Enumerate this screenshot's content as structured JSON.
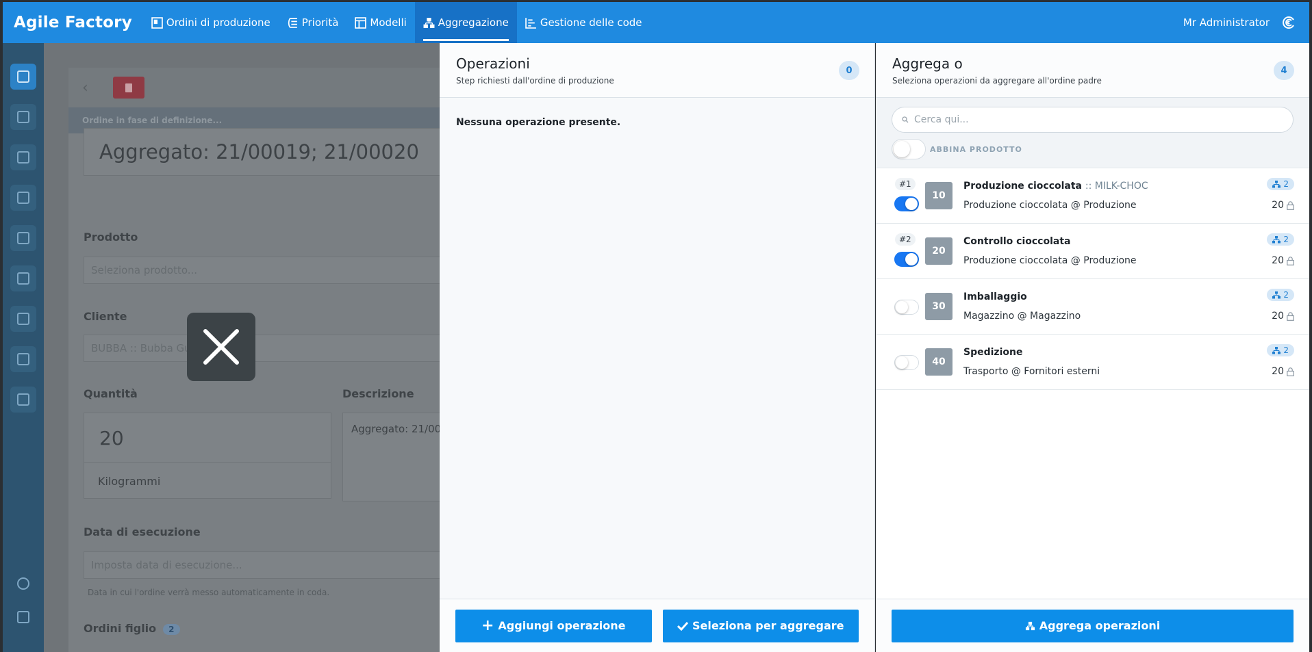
{
  "app": {
    "title": "Agile Factory",
    "user": "Mr Administrator"
  },
  "nav": [
    {
      "label": "Ordini di produzione",
      "icon": "orders-icon",
      "active": false
    },
    {
      "label": "Priorità",
      "icon": "priority-icon",
      "active": false
    },
    {
      "label": "Modelli",
      "icon": "models-icon",
      "active": false
    },
    {
      "label": "Aggregazione",
      "icon": "aggregation-icon",
      "active": true
    },
    {
      "label": "Gestione delle code",
      "icon": "queue-icon",
      "active": false
    }
  ],
  "background_form": {
    "status": "Ordine in fase di definizione...",
    "title": "Aggregato: 21/00019; 21/00020",
    "product_label": "Prodotto",
    "product_placeholder": "Seleziona prodotto...",
    "client_label": "Cliente",
    "client_value": "BUBBA :: Bubba Gum",
    "qty_label": "Quantità",
    "qty_value": "20",
    "unit_value": "Kilogrammi",
    "desc_label": "Descrizione",
    "desc_value": "Aggregato: 21/00",
    "date_label": "Data di esecuzione",
    "date_placeholder": "Imposta data di esecuzione...",
    "date_hint": "Data in cui l'ordine verrà messo automaticamente in coda.",
    "children_label": "Ordini figlio",
    "children_count": "2"
  },
  "operations_panel": {
    "title": "Operazioni",
    "subtitle": "Step richiesti dall'ordine di produzione",
    "count": "0",
    "empty": "Nessuna operazione presente.",
    "add_button": "Aggiungi operazione",
    "select_button": "Seleziona per aggregare"
  },
  "aggregate_panel": {
    "title": "Aggrega o",
    "subtitle": "Seleziona operazioni da aggregare all'ordine padre",
    "count": "4",
    "search_placeholder": "Cerca qui...",
    "match_product_label": "ABBINA PRODOTTO",
    "aggregate_button": "Aggrega operazioni",
    "operations": [
      {
        "index": "#1",
        "selected": true,
        "number": "10",
        "name": "Produzione cioccolata",
        "code": ":: MILK-CHOC",
        "place": "Produzione cioccolata @ Produzione",
        "aggregated": "2",
        "qty": "20"
      },
      {
        "index": "#2",
        "selected": true,
        "number": "20",
        "name": "Controllo cioccolata",
        "code": "",
        "place": "Produzione cioccolata @ Produzione",
        "aggregated": "2",
        "qty": "20"
      },
      {
        "index": "",
        "selected": false,
        "number": "30",
        "name": "Imballaggio",
        "code": "",
        "place": "Magazzino @ Magazzino",
        "aggregated": "2",
        "qty": "20"
      },
      {
        "index": "",
        "selected": false,
        "number": "40",
        "name": "Spedizione",
        "code": "",
        "place": "Trasporto @ Fornitori esterni",
        "aggregated": "2",
        "qty": "20"
      }
    ]
  }
}
